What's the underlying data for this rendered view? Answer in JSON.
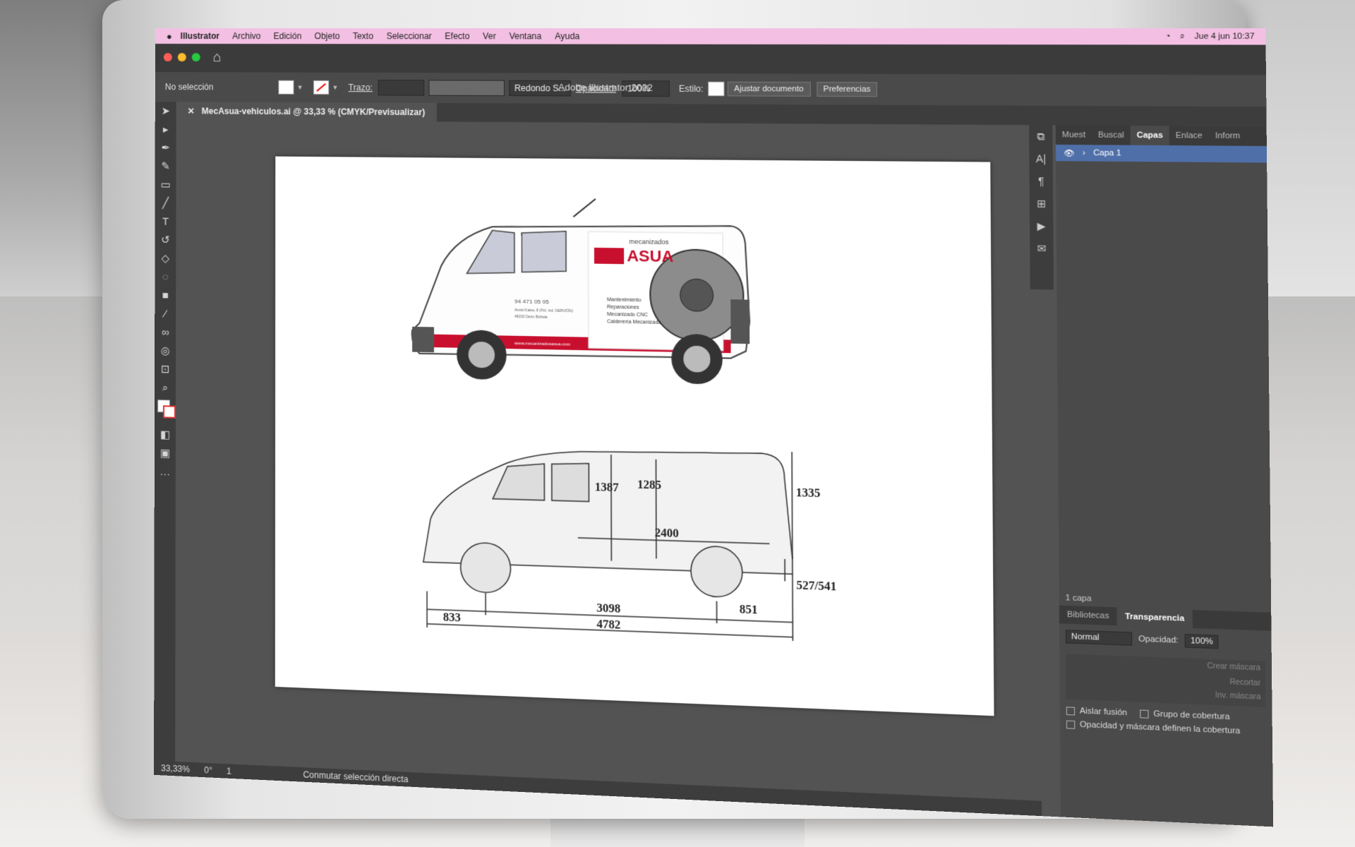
{
  "menubar": {
    "app_name": "Illustrator",
    "items": [
      "Archivo",
      "Edición",
      "Objeto",
      "Texto",
      "Seleccionar",
      "Efecto",
      "Ver",
      "Ventana",
      "Ayuda"
    ],
    "clock": "Jue 4 jun  10:37"
  },
  "window": {
    "title": "Adobe Illustrator 2022"
  },
  "controlbar": {
    "selection": "No selección",
    "stroke_label": "Trazo:",
    "brush": "Redondo S...",
    "opacity_label": "Opacidad:",
    "opacity_value": "100%",
    "style_label": "Estilo:",
    "fit_button": "Ajustar documento",
    "prefs_button": "Preferencias"
  },
  "document": {
    "tab_title": "MecAsua-vehiculos.ai @ 33,33 % (CMYK/Previsualizar)"
  },
  "artboard": {
    "van_brand_small": "mecanizados",
    "van_brand": "ASUA",
    "van_phone": "94 471 05 95",
    "van_address": "Aresti Kalea, 8 (Pol. Ind. NERVIÓN)",
    "van_city": "48150 Derio Bizkaia",
    "van_services": [
      "Mantenimiento",
      "Reparaciones",
      "Mecanizado CNC",
      "Calderería Mecanizada"
    ],
    "van_url": "www.mecanizadosasua.com",
    "dimensions": {
      "inner_height_1": "1387",
      "inner_height_2": "1285",
      "total_height": "1335",
      "cargo_length": "2400",
      "ground_clearance": "527/541",
      "front_overhang": "833",
      "wheelbase": "3098",
      "rear_overhang": "851",
      "total_length": "4782"
    }
  },
  "panels": {
    "tabs": [
      "Muest",
      "Buscal",
      "Capas",
      "Enlace",
      "Inform"
    ],
    "active_tab": "Capas",
    "layer_name": "Capa 1",
    "layer_count": "1 capa",
    "transparency_tabs": [
      "Bibliotecas",
      "Transparencia"
    ],
    "blend_mode": "Normal",
    "opacity_label": "Opacidad:",
    "opacity_value": "100%",
    "mask_buttons": [
      "Crear máscara",
      "Recortar",
      "Inv. máscara"
    ],
    "checkboxes": [
      "Aislar fusión",
      "Grupo de cobertura",
      "Opacidad y máscara definen la cobertura"
    ]
  },
  "statusbar": {
    "zoom": "33,33%",
    "angle": "0°",
    "artboard_num": "1",
    "tool_hint": "Conmutar selección directa"
  },
  "colors": {
    "accent_red": "#c8102e",
    "menubar_pink": "#f3c0e3"
  }
}
